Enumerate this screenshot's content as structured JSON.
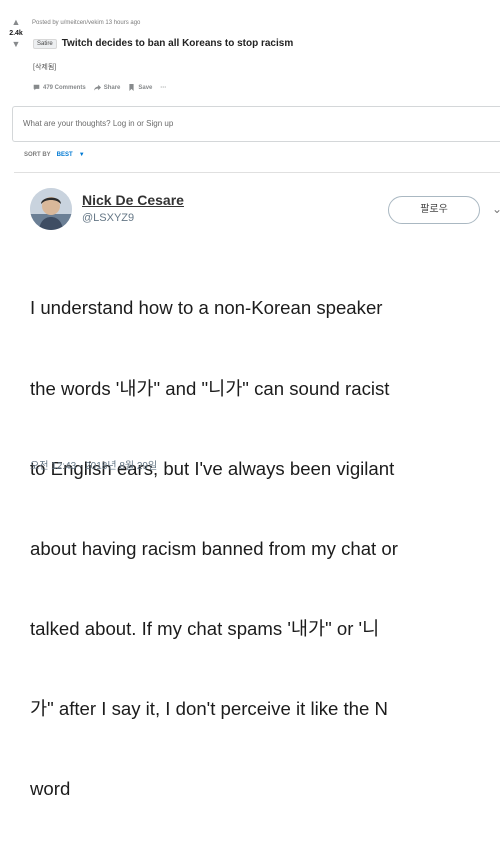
{
  "post": {
    "score": "2.4k",
    "meta": "Posted by u/meitcen/vekim 13 hours ago",
    "flair": "Satire",
    "title": "Twitch decides to ban all Koreans to stop racism",
    "deleted_text": "[삭제됨]",
    "actions": {
      "comments": "479 Comments",
      "share": "Share",
      "save": "Save",
      "more": "···"
    },
    "comment_placeholder": "What are your thoughts? Log in or Sign up",
    "sort": {
      "label": "SORT BY",
      "value": "BEST"
    }
  },
  "tweet": {
    "name": "Nick De Cesare",
    "handle": "@LSXYZ9",
    "follow_label": "팔로우",
    "text_lines": [
      "I understand how to a non-Korean speaker",
      "the words '내가\" and \"니가\" can sound racist",
      "to English ears, but I've always been vigilant",
      "about having racism banned from my chat or",
      "talked about. If my chat spams '내가\" or '니",
      "가\" after I say it, I don't perceive it like the N",
      "word"
    ],
    "timestamp": "오전 12:43 - 2018년 8월 29일"
  },
  "icons": {
    "upvote": "upvote-arrow-icon",
    "downvote": "downvote-arrow-icon",
    "comment": "comment-icon",
    "share": "share-arrow-icon",
    "save": "bookmark-icon",
    "sort_chevron": "chevron-down-icon",
    "tweet_caret": "chevron-down-icon"
  },
  "colors": {
    "accent_blue": "#0079d3",
    "tweet_gray": "#657786",
    "vote_gray": "#878a8c"
  }
}
